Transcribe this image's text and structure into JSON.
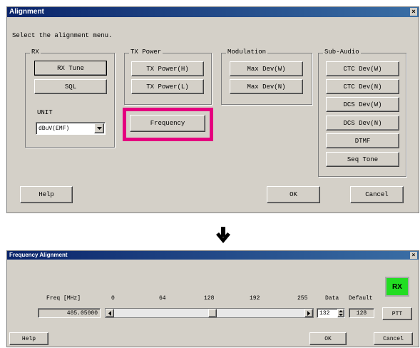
{
  "top_window": {
    "title": "Alignment",
    "close_glyph": "×",
    "instruction": "Select the alignment menu.",
    "rx_group": {
      "label": "RX",
      "rx_tune": "RX Tune",
      "sql": "SQL",
      "unit_label": "UNIT",
      "unit_value": "dBuV(EMF)"
    },
    "tx_power_group": {
      "label": "TX Power",
      "high": "TX Power(H)",
      "low": "TX Power(L)"
    },
    "frequency_button": "Frequency",
    "modulation_group": {
      "label": "Modulation",
      "max_dev_w": "Max Dev(W)",
      "max_dev_n": "Max Dev(N)"
    },
    "sub_audio_group": {
      "label": "Sub-Audio",
      "ctc_w": "CTC Dev(W)",
      "ctc_n": "CTC Dev(N)",
      "dcs_w": "DCS Dev(W)",
      "dcs_n": "DCS Dev(N)",
      "dtmf": "DTMF",
      "seq_tone": "Seq Tone"
    },
    "help": "Help",
    "ok": "OK",
    "cancel": "Cancel"
  },
  "bottom_window": {
    "title": "Frequency Alignment",
    "close_glyph": "×",
    "freq_label": "Freq [MHz]",
    "freq_value": "485.05000",
    "scale_ticks": [
      "0",
      "64",
      "128",
      "192",
      "255"
    ],
    "data_label": "Data",
    "default_label": "Default",
    "data_value": "132",
    "default_value": "128",
    "rx_indicator": "RX",
    "ptt": "PTT",
    "help": "Help",
    "ok": "OK",
    "cancel": "Cancel",
    "slider_value": 132,
    "slider_max": 255
  },
  "colors": {
    "highlight": "#e4007f",
    "rx_indicator": "#22dd22",
    "title_bar": "#0a246a",
    "face": "#d4d0c8"
  },
  "icons": [
    "down-arrow-icon",
    "dropdown-arrow-icon",
    "scroll-left-icon",
    "scroll-right-icon",
    "spin-icon",
    "close-icon"
  ]
}
